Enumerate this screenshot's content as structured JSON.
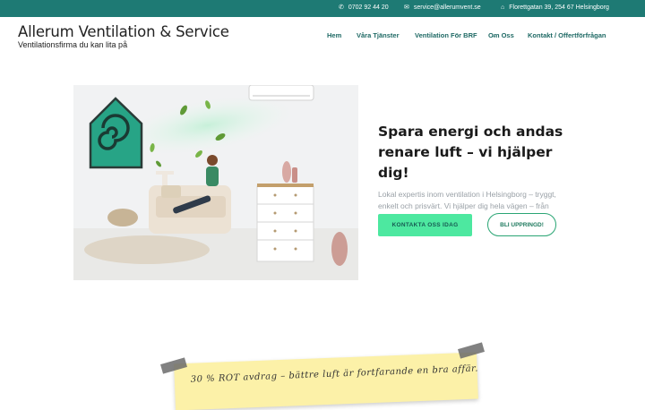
{
  "topbar": {
    "phone": "0702 92 44 20",
    "email": "service@allerumvent.se",
    "address": "Florettgatan 39, 254 67 Helsingborg",
    "phone_icon": "phone-icon",
    "email_icon": "envelope-icon",
    "address_icon": "home-icon"
  },
  "brand": {
    "title": "Allerum Ventilation & Service",
    "tagline": "Ventilationsfirma du kan lita på"
  },
  "nav": {
    "items": [
      "Hem",
      "Våra Tjänster",
      "Ventilation För BRF",
      "Om Oss",
      "Kontakt / Offertförfrågan"
    ],
    "dropdown_caret": "–"
  },
  "hero": {
    "heading": "Spara energi och andas renare luft – vi hjälper dig!",
    "body": "Lokal expertis inom ventilation i Helsingborg – tryggt, enkelt och prisvärt. Vi hjälper dig hela vägen – från felsökning till färdig lösning.",
    "primary_cta": "KONTAKTA OSS IDAG",
    "secondary_cta": "BLI UPPRINGD!"
  },
  "note": {
    "text": "30 % ROT avdrag – bättre luft är fortfarande en bra affär."
  },
  "colors": {
    "topbar": "#1e7a74",
    "nav_text": "#1e6964",
    "primary_button": "#4de8a0",
    "outline_button": "#2aa574",
    "note_background": "#fcf1a8",
    "logo_green": "#2bb58a"
  }
}
